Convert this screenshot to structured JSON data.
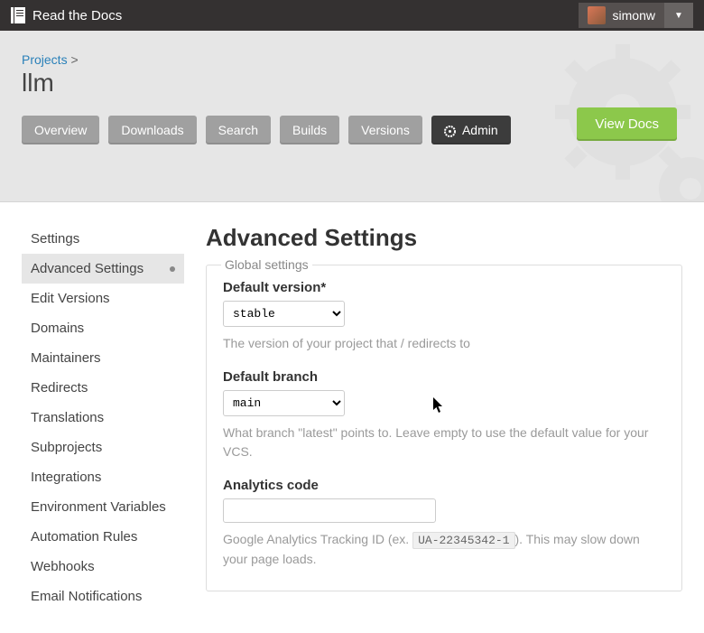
{
  "topbar": {
    "brand": "Read the Docs",
    "username": "simonw"
  },
  "header": {
    "breadcrumb_root": "Projects",
    "breadcrumb_sep": ">",
    "project_name": "llm",
    "view_docs": "View Docs",
    "tabs": {
      "overview": "Overview",
      "downloads": "Downloads",
      "search": "Search",
      "builds": "Builds",
      "versions": "Versions",
      "admin": "Admin"
    }
  },
  "sidebar": {
    "settings": "Settings",
    "advanced_settings": "Advanced Settings",
    "edit_versions": "Edit Versions",
    "domains": "Domains",
    "maintainers": "Maintainers",
    "redirects": "Redirects",
    "translations": "Translations",
    "subprojects": "Subprojects",
    "integrations": "Integrations",
    "env_vars": "Environment Variables",
    "automation_rules": "Automation Rules",
    "webhooks": "Webhooks",
    "email_notifications": "Email Notifications"
  },
  "content": {
    "title": "Advanced Settings",
    "legend": "Global settings",
    "default_version": {
      "label": "Default version*",
      "value": "stable",
      "help": "The version of your project that / redirects to"
    },
    "default_branch": {
      "label": "Default branch",
      "value": "main",
      "help": "What branch \"latest\" points to. Leave empty to use the default value for your VCS."
    },
    "analytics": {
      "label": "Analytics code",
      "value": "",
      "help_pre": "Google Analytics Tracking ID (ex. ",
      "help_code": "UA-22345342-1",
      "help_post": "). This may slow down your page loads."
    }
  }
}
